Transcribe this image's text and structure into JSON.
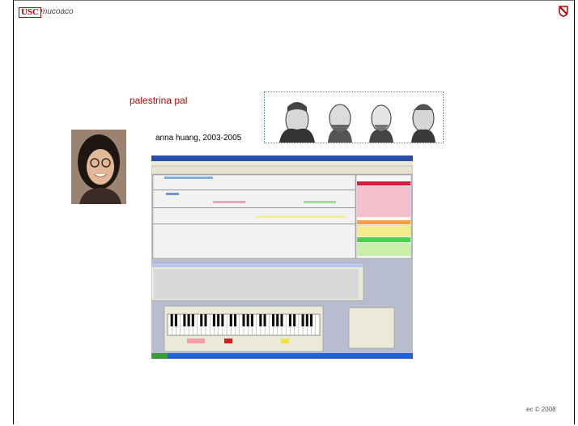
{
  "header": {
    "logo": "USC",
    "subtitle": "mucoaco"
  },
  "title": "palestrina pal",
  "caption": "anna huang, 2003-2005",
  "footer": "ec © 2008",
  "colors": {
    "title": "#c00000",
    "logo": "#b00000",
    "border": "#4a7fc0"
  },
  "images": {
    "composers": "four composer engraving portraits",
    "portrait": "photo of smiling woman with glasses",
    "screenshot": "music composition software window with score, sidebar list, message panel, piano keyboard"
  }
}
